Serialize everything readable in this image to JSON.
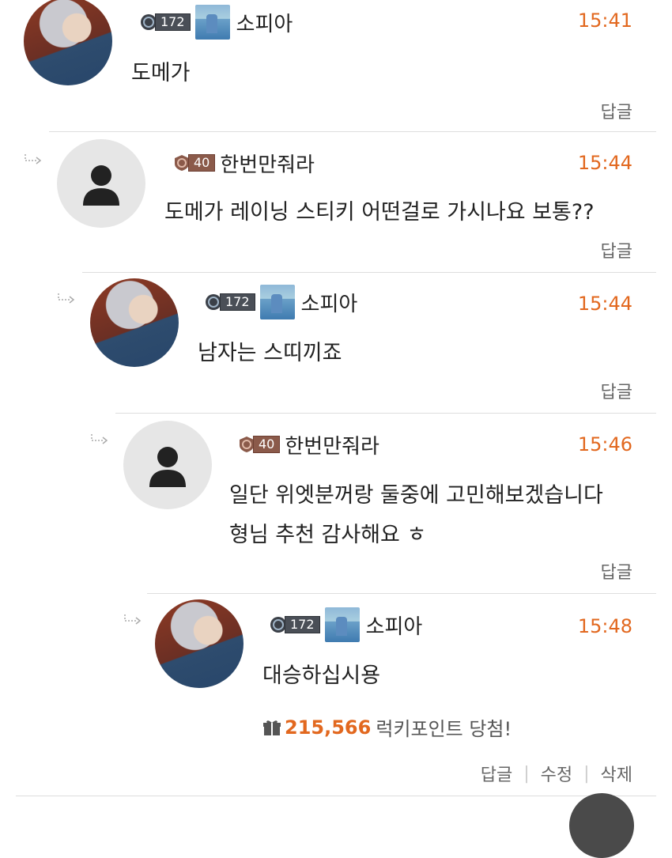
{
  "comments": [
    {
      "level": "172",
      "nickname": "소피아",
      "time": "15:41",
      "lines": [
        "도메가"
      ],
      "reply_label": "답글"
    },
    {
      "level": "40",
      "nickname": "한번만줘라",
      "time": "15:44",
      "lines": [
        "도메가 레이닝 스티키 어떤걸로 가시나요 보통??"
      ],
      "reply_label": "답글"
    },
    {
      "level": "172",
      "nickname": "소피아",
      "time": "15:44",
      "lines": [
        "남자는 스띠끼죠"
      ],
      "reply_label": "답글"
    },
    {
      "level": "40",
      "nickname": "한번만줘라",
      "time": "15:46",
      "lines": [
        "일단 위엣분꺼랑 둘중에 고민해보겠습니다",
        "형님 추천 감사해요 ㅎ"
      ],
      "reply_label": "답글"
    },
    {
      "level": "172",
      "nickname": "소피아",
      "time": "15:48",
      "lines": [
        "대승하십시용"
      ],
      "reply_label": "답글",
      "edit_label": "수정",
      "delete_label": "삭제"
    }
  ],
  "lucky": {
    "points": "215,566",
    "text": "럭키포인트 당첨!",
    "icon": "gift-icon"
  },
  "colors": {
    "accent": "#e2681f"
  }
}
